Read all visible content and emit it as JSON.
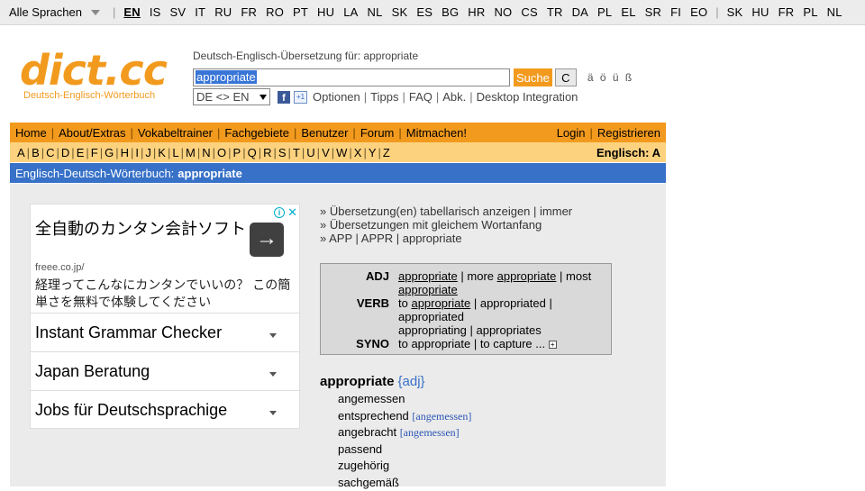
{
  "langbar": {
    "selector": "Alle Sprachen",
    "left_langs": [
      "EN",
      "IS",
      "SV",
      "IT",
      "RU",
      "FR",
      "RO",
      "PT",
      "HU",
      "LA",
      "NL",
      "SK",
      "ES",
      "BG",
      "HR",
      "NO",
      "CS",
      "TR",
      "DA",
      "PL",
      "EL",
      "SR",
      "FI",
      "EO"
    ],
    "active_lang": "EN",
    "right_langs": [
      "SK",
      "HU",
      "FR",
      "PL",
      "NL"
    ]
  },
  "logo": {
    "main": "dict.cc",
    "sub": "Deutsch-Englisch-Wörterbuch"
  },
  "header": {
    "title": "Deutsch-Englisch-Übersetzung für: appropriate",
    "search_value": "appropriate",
    "search_button": "Suche",
    "clear_button": "C",
    "umlauts": "ä ö ü ß",
    "direction": "DE <> EN",
    "fb_icon": "f",
    "gplus_icon": "+1",
    "links": [
      "Optionen",
      "Tipps",
      "FAQ",
      "Abk.",
      "Desktop Integration"
    ]
  },
  "nav": {
    "left": [
      "Home",
      "About/Extras",
      "Vokabeltrainer",
      "Fachgebiete",
      "Benutzer",
      "Forum",
      "Mitmachen!"
    ],
    "right": [
      "Login",
      "Registrieren"
    ]
  },
  "alphabet": {
    "letters": [
      "A",
      "B",
      "C",
      "D",
      "E",
      "F",
      "G",
      "H",
      "I",
      "J",
      "K",
      "L",
      "M",
      "N",
      "O",
      "P",
      "Q",
      "R",
      "S",
      "T",
      "U",
      "V",
      "W",
      "X",
      "Y",
      "Z"
    ],
    "current": "Englisch: A"
  },
  "titlebar": {
    "prefix": "Englisch-Deutsch-Wörterbuch:",
    "word": "appropriate"
  },
  "ad": {
    "jp_title": "全自動のカンタン会計ソフト",
    "domain": "freee.co.jp/",
    "jp_desc": "経理ってこんなにカンタンでいいの？ この簡単さを無料で体験してください",
    "arrow": "→",
    "info": "i",
    "close": "✕",
    "rows": [
      "Instant Grammar Checker",
      "Japan Beratung",
      "Jobs für Deutschsprachige"
    ]
  },
  "links": {
    "l1": "» Übersetzung(en) tabellarisch anzeigen | immer",
    "l2": "» Übersetzungen mit gleichem Wortanfang",
    "l3": "» APP | APPR | appropriate"
  },
  "infobox": {
    "adj_label": "ADJ",
    "adj_1": "appropriate",
    "adj_2": " | more ",
    "adj_3": "appropriate",
    "adj_4": " | most",
    "adj_5": "appropriate",
    "verb_label": "VERB",
    "verb_1": "to ",
    "verb_2": "appropriate",
    "verb_3": " | appropriated |",
    "verb_4": "appropriated",
    "verb_5": "appropriating | appropriates",
    "syno_label": "SYNO",
    "syno_1": "to appropriate | to capture ...",
    "plus": "+"
  },
  "entry": {
    "word": "appropriate",
    "pos": "{adj}",
    "translations": [
      {
        "text": "angemessen",
        "tag": ""
      },
      {
        "text": "entsprechend",
        "tag": "[angemessen]"
      },
      {
        "text": "angebracht",
        "tag": "[angemessen]"
      },
      {
        "text": "passend",
        "tag": ""
      },
      {
        "text": "zugehörig",
        "tag": ""
      },
      {
        "text": "sachgemäß",
        "tag": ""
      }
    ]
  }
}
